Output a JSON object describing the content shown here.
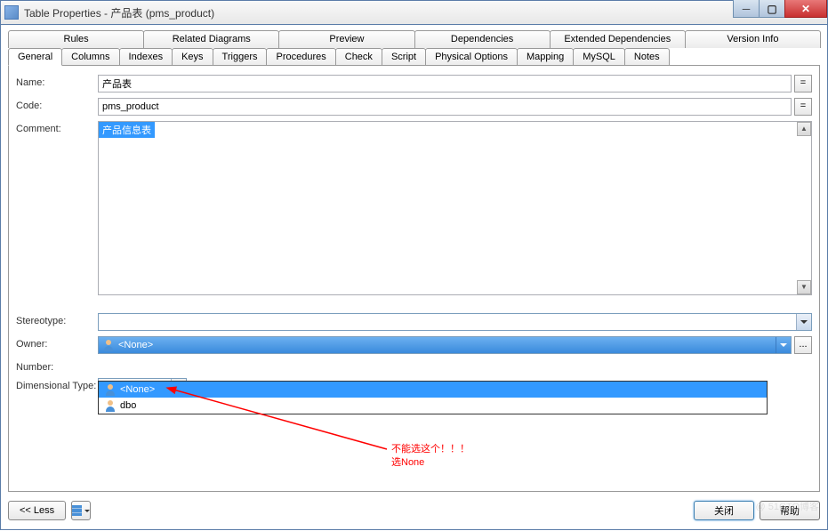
{
  "window": {
    "title": "Table Properties - 产品表 (pms_product)"
  },
  "tabs_row1": [
    "Rules",
    "Related Diagrams",
    "Preview",
    "Dependencies",
    "Extended Dependencies",
    "Version Info"
  ],
  "tabs_row2": [
    "General",
    "Columns",
    "Indexes",
    "Keys",
    "Triggers",
    "Procedures",
    "Check",
    "Script",
    "Physical Options",
    "Mapping",
    "MySQL",
    "Notes"
  ],
  "fields": {
    "name_label": "Name:",
    "name_value": "产品表",
    "code_label": "Code:",
    "code_value": "pms_product",
    "comment_label": "Comment:",
    "comment_value": "产品信息表",
    "stereotype_label": "Stereotype:",
    "stereotype_value": "",
    "owner_label": "Owner:",
    "owner_value": "<None>",
    "number_label": "Number:",
    "number_value": "",
    "dimtype_label": "Dimensional Type:",
    "dimtype_value": "<None>"
  },
  "dropdown": {
    "items": [
      "<None>",
      "dbo"
    ]
  },
  "buttons": {
    "less": "<< Less",
    "close": "关闭",
    "help": "帮助",
    "eq": "=",
    "ellipsis": "..."
  },
  "annotation": {
    "line1": "不能选这个！！！",
    "line2": "选None"
  },
  "watermark": "@ 51CTO博客"
}
